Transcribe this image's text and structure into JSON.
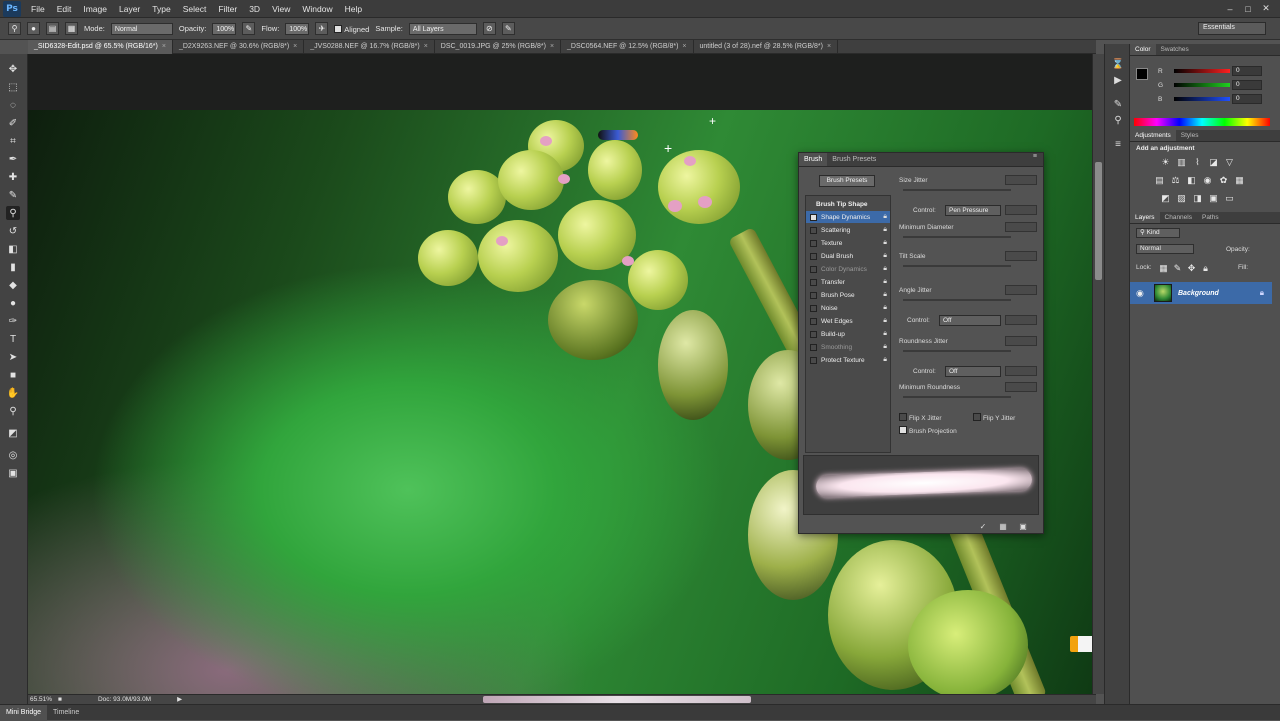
{
  "app": {
    "logo": "Ps"
  },
  "menu": [
    "File",
    "Edit",
    "Image",
    "Layer",
    "Type",
    "Select",
    "Filter",
    "3D",
    "View",
    "Window",
    "Help"
  ],
  "window_controls": [
    "–",
    "□",
    "✕"
  ],
  "options": {
    "mode_label": "Mode:",
    "mode_value": "Normal",
    "opacity_label": "Opacity:",
    "opacity_value": "100%",
    "flow_label": "Flow:",
    "flow_value": "100%",
    "aligned_label": "Aligned",
    "sample_label": "Sample:",
    "sample_value": "All Layers",
    "workspace": "Essentials"
  },
  "doc_tabs": [
    {
      "label": "_SID6328-Edit.psd @ 65.5% (RGB/16*)"
    },
    {
      "label": "_D2X9263.NEF @ 30.6% (RGB/8*)"
    },
    {
      "label": "_JVS0288.NEF @ 16.7% (RGB/8*)"
    },
    {
      "label": "DSC_0019.JPG @ 25% (RGB/8*)"
    },
    {
      "label": "_DSC0564.NEF @ 12.5% (RGB/8*)"
    },
    {
      "label": "untitled (3 of 28).nef @ 28.5% (RGB/8*)"
    }
  ],
  "status": {
    "zoom": "65.51%",
    "doc_size": "Doc: 93.0M/93.0M"
  },
  "bottom_tabs": [
    "Mini Bridge",
    "Timeline"
  ],
  "color_panel": {
    "tabs": [
      "Color",
      "Swatches"
    ],
    "channels": [
      {
        "name": "R",
        "value": "0",
        "color": "#ff2020"
      },
      {
        "name": "G",
        "value": "0",
        "color": "#20d020"
      },
      {
        "name": "B",
        "value": "0",
        "color": "#2050ff"
      }
    ]
  },
  "adjustments_panel": {
    "tabs": [
      "Adjustments",
      "Styles"
    ],
    "heading": "Add an adjustment"
  },
  "layers_panel": {
    "tabs": [
      "Layers",
      "Channels",
      "Paths"
    ],
    "filter_value": "Kind",
    "blend_mode": "Normal",
    "opacity_label": "Opacity:",
    "lock_label": "Lock:",
    "fill_label": "Fill:",
    "layer_name": "Background"
  },
  "brush_panel": {
    "tabs": [
      "Brush",
      "Brush Presets"
    ],
    "presets_button": "Brush Presets",
    "list_header": "Brush Tip Shape",
    "items": [
      {
        "label": "Shape Dynamics",
        "checked": true,
        "selected": true
      },
      {
        "label": "Scattering",
        "checked": false
      },
      {
        "label": "Texture",
        "checked": false
      },
      {
        "label": "Dual Brush",
        "checked": false
      },
      {
        "label": "Color Dynamics",
        "checked": false,
        "dim": true
      },
      {
        "label": "Transfer",
        "checked": false
      },
      {
        "label": "Brush Pose",
        "checked": false
      },
      {
        "label": "Noise",
        "checked": false
      },
      {
        "label": "Wet Edges",
        "checked": false
      },
      {
        "label": "Build-up",
        "checked": false
      },
      {
        "label": "Smoothing",
        "checked": false,
        "dim": true
      },
      {
        "label": "Protect Texture",
        "checked": false
      }
    ],
    "size_jitter": "Size Jitter",
    "control_label": "Control:",
    "control_value_1": "Pen Pressure",
    "minimum_diameter": "Minimum Diameter",
    "tilt_scale": "Tilt Scale",
    "angle_jitter": "Angle Jitter",
    "control_value_2": "Off",
    "roundness_jitter": "Roundness Jitter",
    "control_value_3": "Off",
    "minimum_roundness": "Minimum Roundness",
    "flip_x": "Flip X Jitter",
    "flip_y": "Flip Y Jitter",
    "brush_projection": "Brush Projection"
  },
  "colors": {
    "accent": "#3c6aa8",
    "ps_blue": "#6bb6ff"
  }
}
